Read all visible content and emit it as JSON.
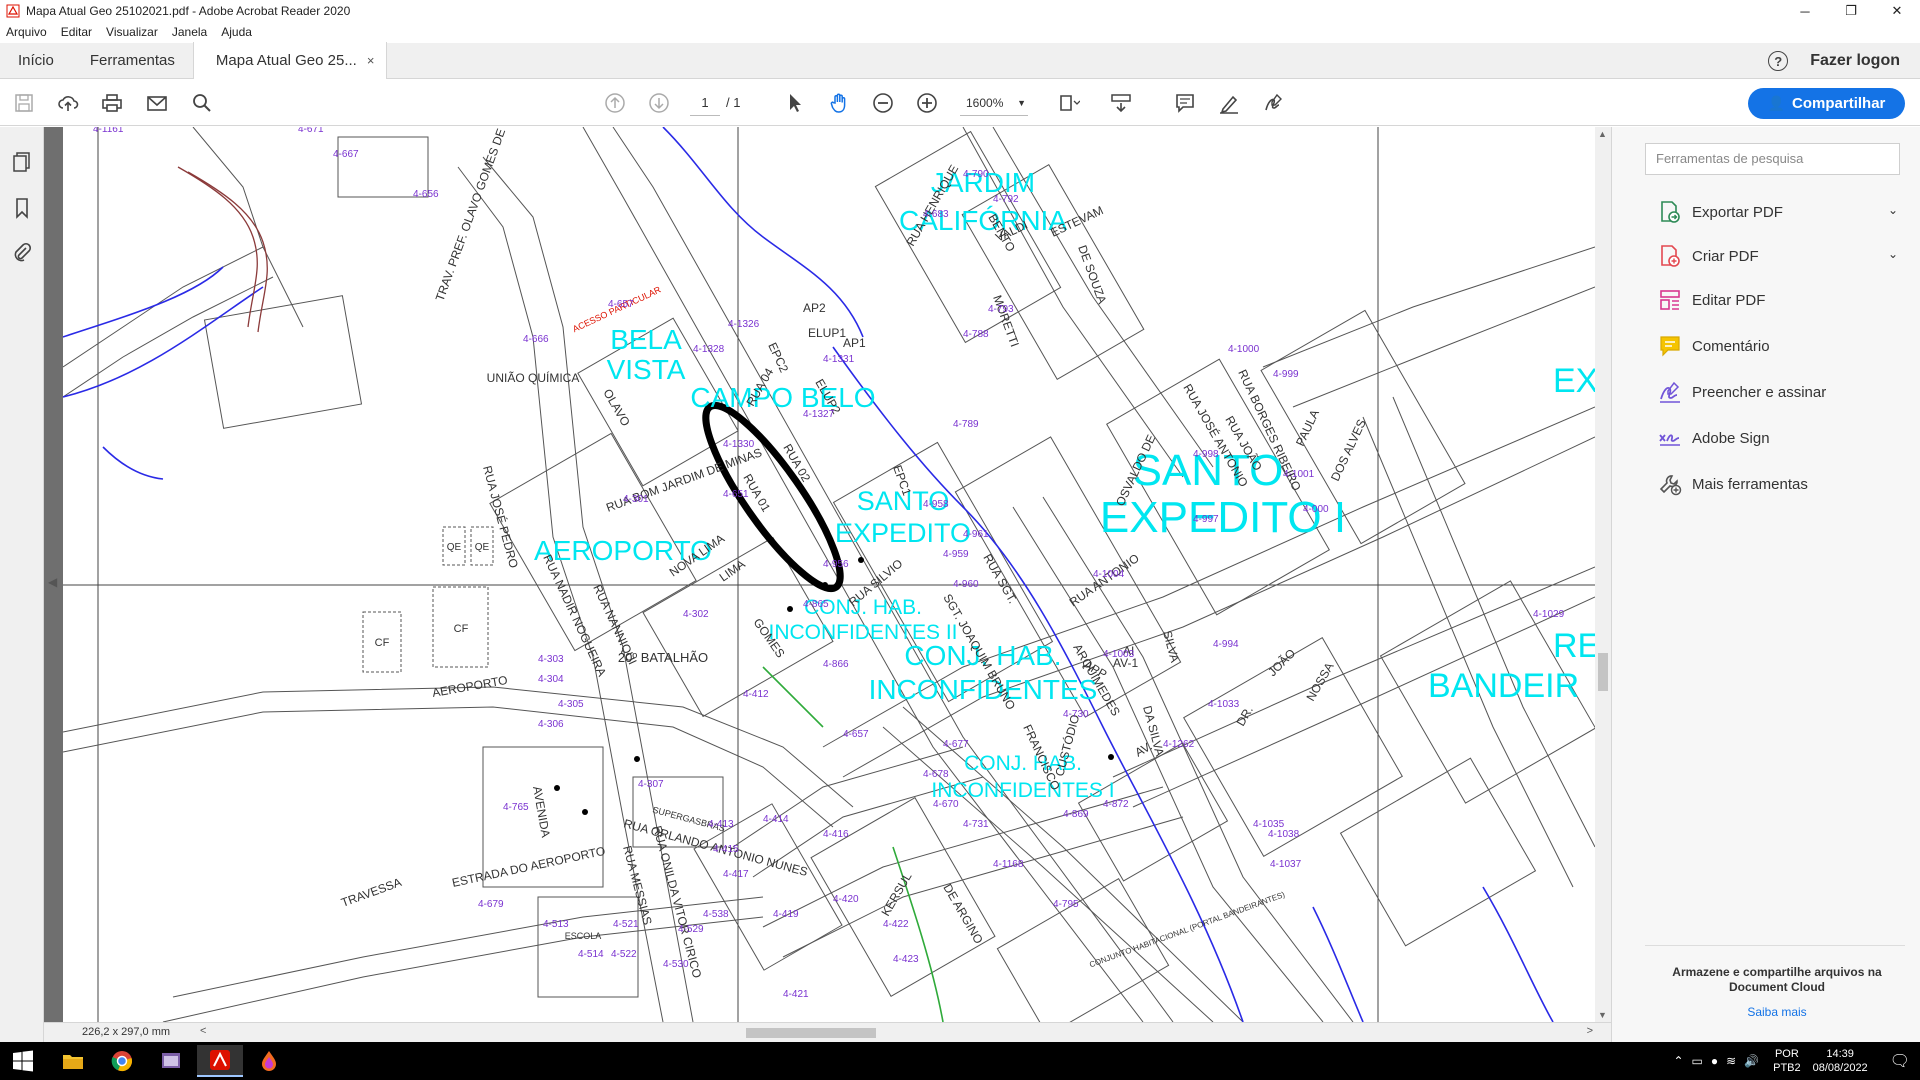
{
  "window": {
    "title": "Mapa Atual Geo 25102021.pdf - Adobe Acrobat Reader 2020",
    "controls": {
      "minimize": "─",
      "restore": "❐",
      "close": "✕"
    }
  },
  "menu": [
    "Arquivo",
    "Editar",
    "Visualizar",
    "Janela",
    "Ajuda"
  ],
  "tabs": {
    "home": "Início",
    "tools": "Ferramentas",
    "document": "Mapa Atual Geo 25...",
    "close": "×",
    "help": "?",
    "login": "Fazer logon"
  },
  "toolbar": {
    "current_page": "1",
    "total_pages": "/ 1",
    "zoom": "1600%",
    "share_label": "Compartilhar"
  },
  "status": {
    "page_size": "226,2 x 297,0 mm",
    "left_arrow": "<",
    "right_arrow": ">"
  },
  "right_panel": {
    "search_placeholder": "Ferramentas de pesquisa",
    "tools": [
      {
        "label": "Exportar PDF",
        "icon": "export-pdf-icon",
        "expandable": true
      },
      {
        "label": "Criar PDF",
        "icon": "create-pdf-icon",
        "expandable": true
      },
      {
        "label": "Editar PDF",
        "icon": "edit-pdf-icon",
        "expandable": false
      },
      {
        "label": "Comentário",
        "icon": "comment-icon",
        "expandable": false
      },
      {
        "label": "Preencher e assinar",
        "icon": "fill-sign-icon",
        "expandable": false
      },
      {
        "label": "Adobe Sign",
        "icon": "adobe-sign-icon",
        "expandable": false
      },
      {
        "label": "Mais ferramentas",
        "icon": "more-tools-icon",
        "expandable": false
      }
    ],
    "cloud_message": "Armazene e compartilhe arquivos na Document Cloud",
    "learn_more": "Saiba mais"
  },
  "map": {
    "neighborhoods": [
      "JARDIM",
      "CALIFÓRNIA",
      "BELA",
      "VISTA",
      "CAMPO BELO",
      "SANTO",
      "EXPEDITO",
      "SANTO",
      "EXPEDITO I",
      "AEROPORTO",
      "CONJ. HAB.",
      "INCONFIDENTES II",
      "CONJ. HAB.",
      "INCONFIDENTES",
      "CONJ. HAB.",
      "INCONFIDENTES I",
      "RE",
      "BANDEIR",
      "EX"
    ],
    "places": [
      "UNIÃO QUÍMICA",
      "20º BATALHÃO",
      "ESCOLA",
      "SUPERGASBRAS",
      "QE",
      "QE",
      "CF",
      "CF",
      "CONJUNTO HABITACIONAL (PORTAL BANDEIRANTES)",
      "ACESSO PARTICULAR"
    ],
    "streets": [
      "TRAV. PREF. OLAVO GOMES DE OLIVEIRA",
      "RUA JOSÉ PEDRO",
      "RUA NADIR NOGUEIRA",
      "RUA NANNIQUI",
      "RUA BOM JARDIM DE MINAS",
      "NOVA LIMA",
      "RUA 01",
      "RUA 02",
      "RUA 04",
      "ESTRADA DO AEROPORTO",
      "TRAVESSA",
      "AVENIDA",
      "RUA ORLANDO ANTONIO NUNES",
      "RUA MESSIAS",
      "RUA ONILDA VITOR CIRICO",
      "RUA SILVIO",
      "SGT. JOAQUIM BRUNO",
      "RUA SGT.",
      "ARQUIMEDES",
      "RUA JOSÉ ANTONIO",
      "RUA BORGES RIBEIRO",
      "PAULA",
      "DOS ALVES",
      "RUA ANTONIO",
      "OSVALDO DE",
      "SILVA",
      "AV.",
      "APP",
      "AV-1",
      "AI",
      "DE ARGINO",
      "RUA HENRIQUE",
      "BENTO",
      "VALDI",
      "ESTEVAM",
      "DE SOUZA",
      "MORETTI",
      "RUA JOÃO",
      "ELUP1",
      "ELUP2",
      "EPC1",
      "EPC2",
      "AP2",
      "AP1",
      "OLAVO",
      "GOMES",
      "LIMA",
      "KERSUL",
      "AEROPORTO",
      "CUSTÓDIO",
      "FRANCISCO",
      "DA SILVA",
      "NOSSA",
      "JOÃO",
      "DR."
    ],
    "lot_codes": [
      "4-1161",
      "4-671",
      "4-667",
      "4-656",
      "4-657",
      "4-666",
      "4-1328",
      "4-1326",
      "4-1331",
      "4-1327",
      "4-1330",
      "4-651",
      "4-301",
      "4-302",
      "4-303",
      "4-304",
      "4-305",
      "4-306",
      "4-307",
      "4-412",
      "4-413",
      "4-414",
      "4-415",
      "4-416",
      "4-417",
      "4-419",
      "4-420",
      "4-421",
      "4-422",
      "4-423",
      "4-513",
      "4-514",
      "4-521",
      "4-522",
      "4-529",
      "4-530",
      "4-538",
      "4-657",
      "4-679",
      "4-765",
      "4-956",
      "4-958",
      "4-959",
      "4-960",
      "4-961",
      "4-865",
      "4-866",
      "4-677",
      "4-678",
      "4-731",
      "4-1168",
      "4-730",
      "4-869",
      "4-872",
      "4-1262",
      "4-1033",
      "4-1035",
      "4-1037",
      "4-1038",
      "4-1029",
      "4-1003",
      "4-1004",
      "4-994",
      "4-997",
      "4-998",
      "4-999",
      "4-1000",
      "4-1001",
      "4-000",
      "4-789",
      "4-790",
      "4-792",
      "4-793",
      "4-788",
      "4-683",
      "4-795",
      "4-670"
    ]
  },
  "taskbar": {
    "lang_top": "POR",
    "lang_bottom": "PTB2",
    "time": "14:39",
    "date": "08/08/2022",
    "tray_up": "⌃"
  },
  "colors": {
    "accent": "#1473e6",
    "map_label": "#00e6f0",
    "lot_code": "#7a32d0",
    "river": "#2a2ae6",
    "highlight_ring": "#000000"
  }
}
